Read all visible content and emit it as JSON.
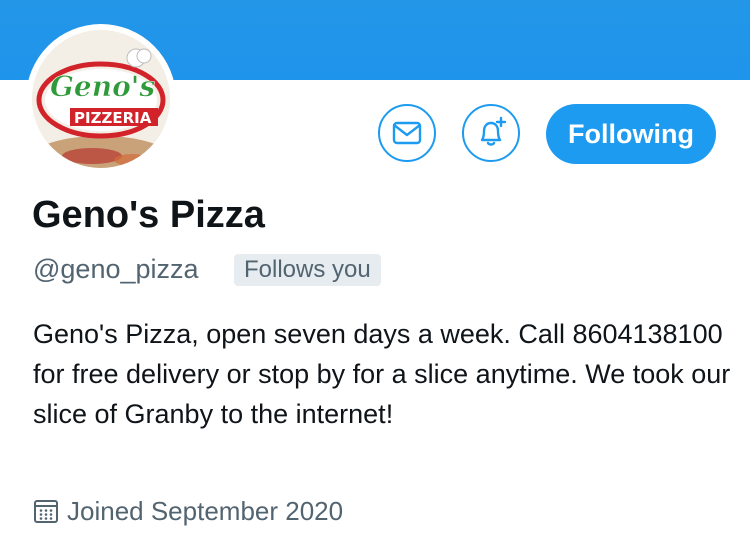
{
  "colors": {
    "accent": "#1d9bf0",
    "banner": "#1e94ea",
    "text_primary": "#0f1419",
    "text_secondary": "#536471",
    "badge_bg": "#e6ecf0"
  },
  "avatar": {
    "logo_text_line1": "Geno's",
    "logo_text_line2": "PIZZERIA"
  },
  "actions": {
    "message_icon": "envelope-icon",
    "notify_icon": "bell-plus-icon",
    "follow_label": "Following"
  },
  "profile": {
    "name": "Geno's Pizza",
    "handle": "@geno_pizza",
    "follows_you": "Follows you",
    "bio": "Geno's Pizza, open seven days a week. Call 8604138100 for free delivery or stop by for a slice anytime. We took our slice of Granby to the internet!",
    "joined": "Joined September 2020",
    "joined_icon": "calendar-icon"
  }
}
